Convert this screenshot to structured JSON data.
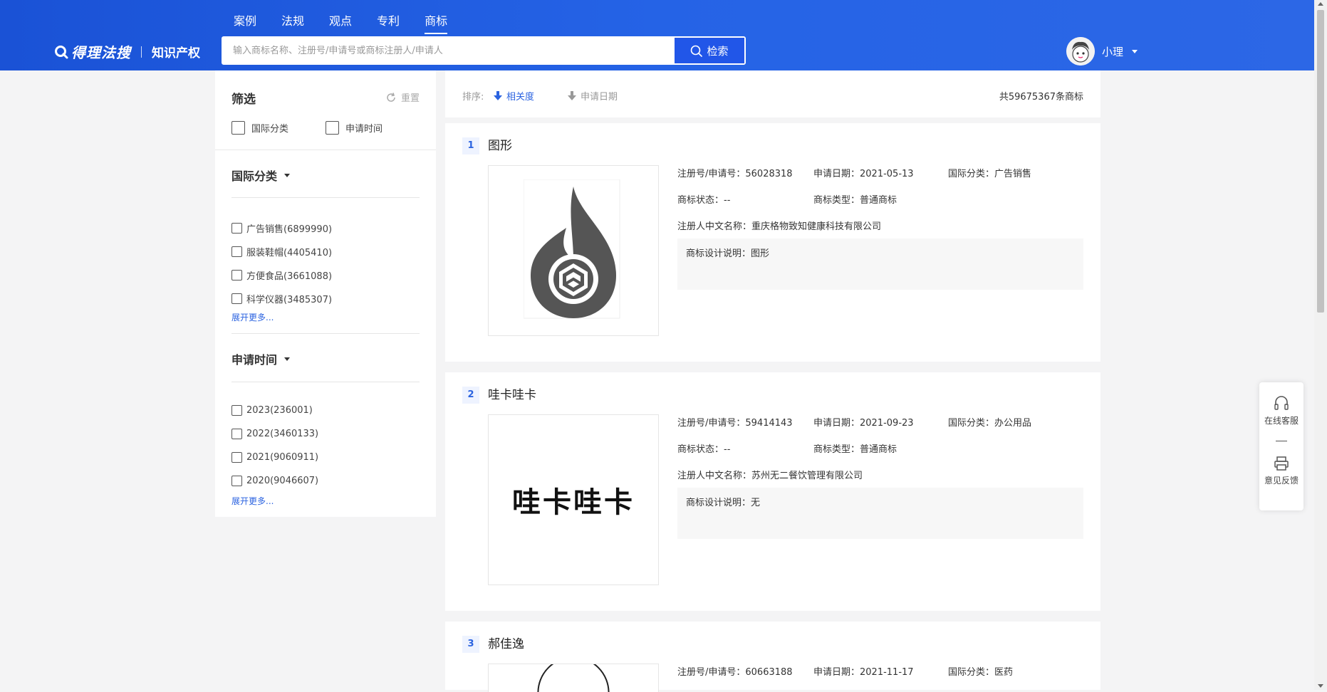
{
  "nav": {
    "items": [
      "案例",
      "法规",
      "观点",
      "专利",
      "商标"
    ],
    "active": "商标"
  },
  "logo": {
    "brand": "得理法搜",
    "sub": "知识产权"
  },
  "search": {
    "placeholder": "输入商标名称、注册号/申请号或商标注册人/申请人",
    "button": "检索"
  },
  "user": {
    "name": "小理"
  },
  "sidebar": {
    "title": "筛选",
    "reset": "重置",
    "top_filters": [
      "国际分类",
      "申请时间"
    ],
    "sections": [
      {
        "title": "国际分类",
        "options": [
          "广告销售(6899990)",
          "服装鞋帽(4405410)",
          "方便食品(3661088)",
          "科学仪器(3485307)"
        ],
        "more": "展开更多..."
      },
      {
        "title": "申请时间",
        "options": [
          "2023(236001)",
          "2022(3460133)",
          "2021(9060911)",
          "2020(9046607)"
        ],
        "more": "展开更多..."
      }
    ]
  },
  "sort": {
    "label": "排序:",
    "relevance": "相关度",
    "date": "申请日期",
    "total": "共59675367条商标"
  },
  "results": [
    {
      "index": "1",
      "title": "图形",
      "reg_no": "注册号/申请号：56028318",
      "app_date": "申请日期：2021-05-13",
      "intl_class": "国际分类：广告销售",
      "status": "商标状态：--",
      "type": "商标类型：普通商标",
      "owner": "注册人中文名称：重庆格物致知健康科技有限公司",
      "design": "商标设计说明：图形",
      "image": "logo-drop"
    },
    {
      "index": "2",
      "title": "哇卡哇卡",
      "reg_no": "注册号/申请号：59414143",
      "app_date": "申请日期：2021-09-23",
      "intl_class": "国际分类：办公用品",
      "status": "商标状态：--",
      "type": "商标类型：普通商标",
      "owner": "注册人中文名称：苏州无二餐饮管理有限公司",
      "design": "商标设计说明：无",
      "image_text": "哇卡哇卡"
    },
    {
      "index": "3",
      "title": "郝佳逸",
      "reg_no": "注册号/申请号：60663188",
      "app_date": "申请日期：2021-11-17",
      "intl_class": "国际分类：医药"
    }
  ],
  "float": {
    "service": "在线客服",
    "feedback": "意见反馈"
  },
  "colors": {
    "header": "#1a52d6",
    "accent": "#2b63e0",
    "search_button": "#2156e8"
  }
}
